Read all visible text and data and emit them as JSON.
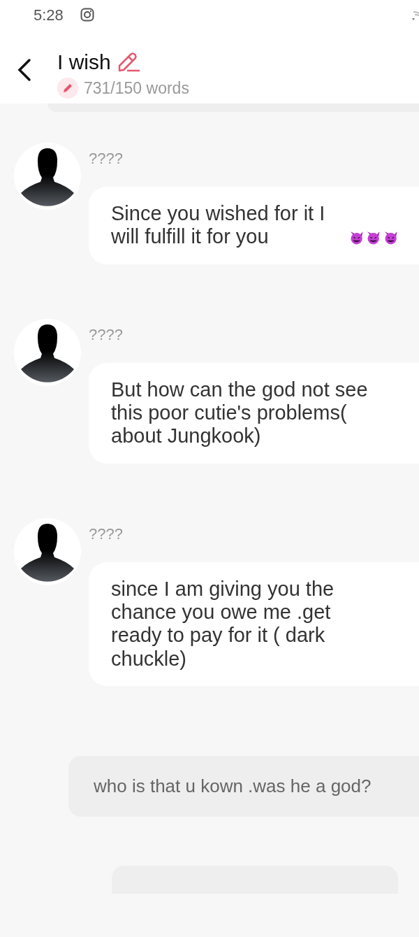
{
  "status_bar": {
    "time": "5:28"
  },
  "header": {
    "title": "I wish",
    "word_count": "731/150 words"
  },
  "messages": [
    {
      "kind": "incoming",
      "sender": "????",
      "text": "Since you wished for it I will fulfill it for you",
      "emojis": [
        {
          "kind": "devil"
        },
        {
          "kind": "devil"
        },
        {
          "kind": "devil"
        }
      ]
    },
    {
      "kind": "incoming",
      "sender": "????",
      "text": "But how can the god not see this poor cutie's problems( about Jungkook)"
    },
    {
      "kind": "incoming",
      "sender": "????",
      "text": "since I am giving you the chance you owe me .get ready to pay for it ( dark chuckle)"
    },
    {
      "kind": "outgoing",
      "text": "who is that u kown .was he a god?"
    },
    {
      "kind": "outgoing"
    }
  ]
}
